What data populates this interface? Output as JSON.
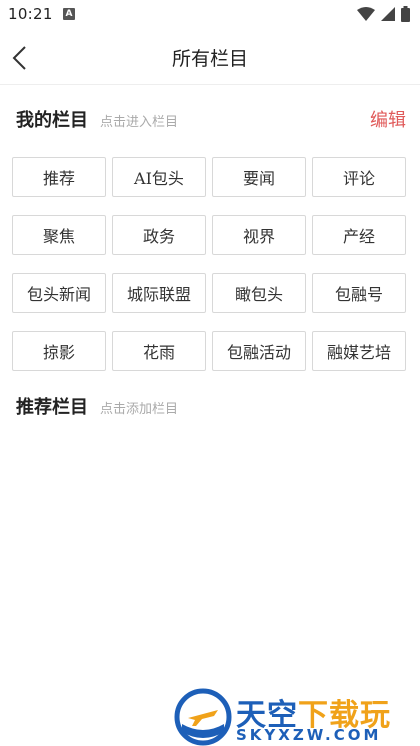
{
  "status_bar": {
    "time": "10:21",
    "app_icon_letter": "A"
  },
  "header": {
    "title": "所有栏目"
  },
  "my_channels": {
    "title": "我的栏目",
    "hint": "点击进入栏目",
    "edit_label": "编辑",
    "items": [
      "推荐",
      "AI包头",
      "要闻",
      "评论",
      "聚焦",
      "政务",
      "视界",
      "产经",
      "包头新闻",
      "城际联盟",
      "瞰包头",
      "包融号",
      "掠影",
      "花雨",
      "包融活动",
      "融媒艺培"
    ]
  },
  "recommended_channels": {
    "title": "推荐栏目",
    "hint": "点击添加栏目"
  },
  "watermark": {
    "brand_part1": "天空",
    "brand_part2": "下载玩",
    "domain": "SKYXZW.COM"
  },
  "colors": {
    "accent": "#e05a5a",
    "hint": "#aaaaaa",
    "border": "#d8d8d8",
    "watermark_blue": "#1d5fb8",
    "watermark_orange": "#f0a21a"
  }
}
